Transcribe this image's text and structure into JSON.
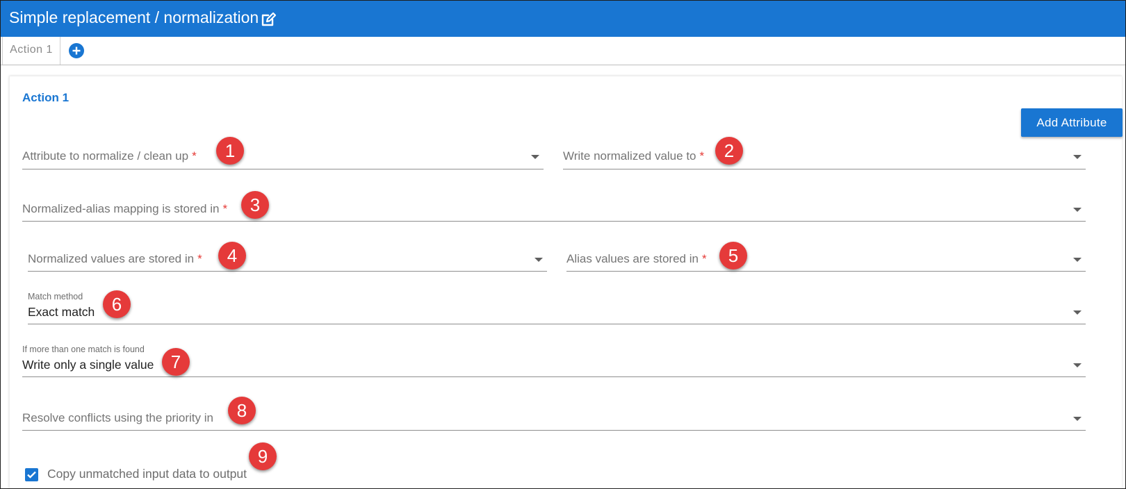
{
  "header": {
    "title": "Simple replacement / normalization",
    "edit_icon": "edit-icon"
  },
  "tabs": [
    {
      "label": "Action 1"
    }
  ],
  "add_tab_icon": "plus-circle-icon",
  "action": {
    "title": "Action 1",
    "add_attribute_label": "Add Attribute",
    "fields": {
      "attribute": {
        "label": "Attribute to normalize / clean up",
        "required": "*",
        "badge": "1"
      },
      "write_to": {
        "label": "Write normalized value to",
        "required": "*",
        "badge": "2"
      },
      "mapping": {
        "label": "Normalized-alias mapping is stored in",
        "required": "*",
        "badge": "3"
      },
      "normalized_values": {
        "label": "Normalized values are stored in",
        "required": "*",
        "badge": "4"
      },
      "alias_values": {
        "label": "Alias values are stored in",
        "required": "*",
        "badge": "5"
      },
      "match_method": {
        "label": "Match method",
        "value": "Exact match",
        "badge": "6"
      },
      "multiple_match": {
        "label": "If more than one match is found",
        "value": "Write only a single value",
        "badge": "7"
      },
      "priority": {
        "label": "Resolve conflicts using the priority in",
        "badge": "8"
      }
    },
    "copy_unmatched": {
      "label": "Copy unmatched input data to output",
      "checked": true,
      "badge": "9"
    }
  },
  "colors": {
    "primary": "#1976d2",
    "badge": "#e53a3a",
    "required": "#e53935"
  }
}
